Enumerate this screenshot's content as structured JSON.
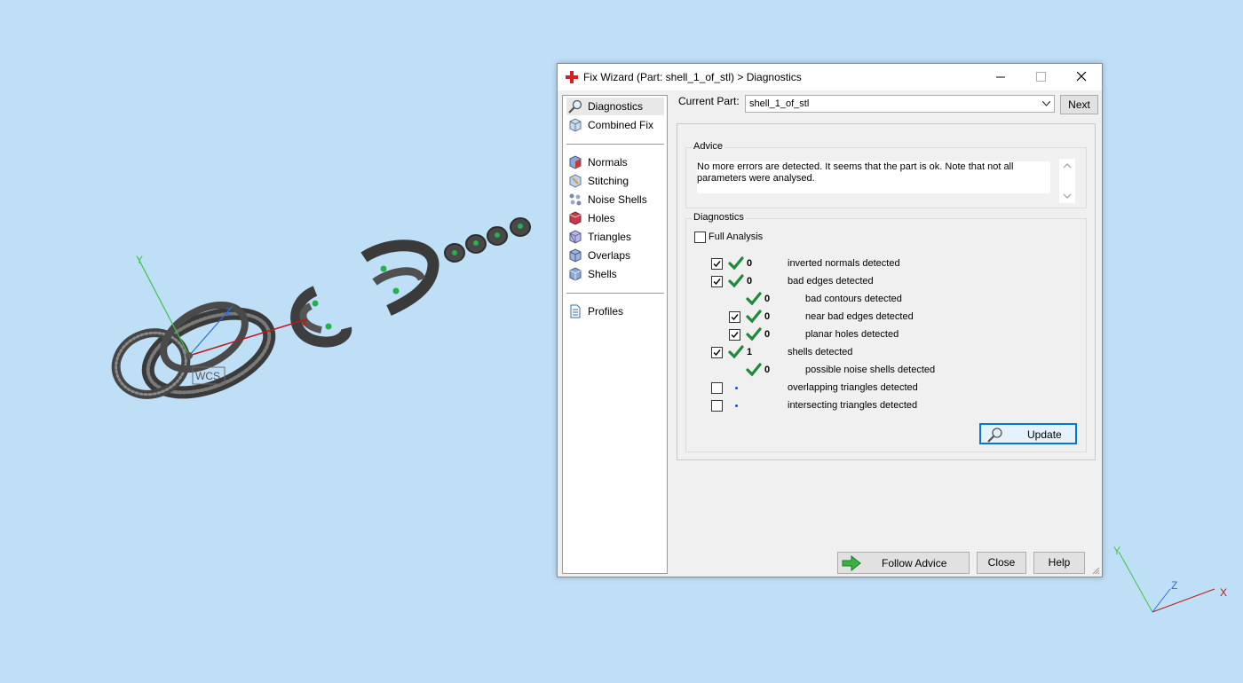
{
  "viewport": {
    "axis_labels": {
      "x": "X",
      "y": "Y",
      "z": "Z"
    },
    "wcs_label": "WCS",
    "colors": {
      "background": "#bfdff7",
      "model": "#4a4a4a",
      "marker": "#22b14c"
    }
  },
  "dialog": {
    "title": "Fix Wizard (Part: shell_1_of_stl) > Diagnostics",
    "nav": {
      "group1": [
        {
          "label": "Diagnostics",
          "icon": "magnifier-icon",
          "selected": true
        },
        {
          "label": "Combined Fix",
          "icon": "combined-fix-icon"
        }
      ],
      "group2": [
        {
          "label": "Normals",
          "icon": "normals-icon"
        },
        {
          "label": "Stitching",
          "icon": "stitching-icon"
        },
        {
          "label": "Noise Shells",
          "icon": "noise-shells-icon"
        },
        {
          "label": "Holes",
          "icon": "holes-icon"
        },
        {
          "label": "Triangles",
          "icon": "triangles-icon"
        },
        {
          "label": "Overlaps",
          "icon": "overlaps-icon"
        },
        {
          "label": "Shells",
          "icon": "shells-icon"
        }
      ],
      "group3": [
        {
          "label": "Profiles",
          "icon": "profiles-icon"
        }
      ]
    },
    "current_part": {
      "label": "Current Part:",
      "value": "shell_1_of_stl",
      "next": "Next"
    },
    "advice": {
      "title": "Advice",
      "text": "No more errors are detected. It seems that the part is ok. Note that not all parameters were analysed."
    },
    "diagnostics": {
      "title": "Diagnostics",
      "full_analysis": {
        "label": "Full Analysis",
        "checked": false
      },
      "rows": [
        {
          "checkbox": true,
          "checked": true,
          "status": "ok",
          "count": "0",
          "label": "inverted normals detected",
          "indent": 0
        },
        {
          "checkbox": true,
          "checked": true,
          "status": "ok",
          "count": "0",
          "label": "bad edges detected",
          "indent": 0
        },
        {
          "checkbox": false,
          "checked": false,
          "status": "ok",
          "count": "0",
          "label": "bad contours detected",
          "indent": 1
        },
        {
          "checkbox": true,
          "checked": true,
          "status": "ok",
          "count": "0",
          "label": "near bad edges detected",
          "indent": 1
        },
        {
          "checkbox": true,
          "checked": true,
          "status": "ok",
          "count": "0",
          "label": "planar holes detected",
          "indent": 1
        },
        {
          "checkbox": true,
          "checked": true,
          "status": "ok",
          "count": "1",
          "label": "shells detected",
          "indent": 0
        },
        {
          "checkbox": false,
          "checked": false,
          "status": "ok",
          "count": "0",
          "label": "possible noise shells detected",
          "indent": 1
        },
        {
          "checkbox": true,
          "checked": false,
          "status": "pending",
          "count": "",
          "label": "overlapping triangles detected",
          "indent": 0
        },
        {
          "checkbox": true,
          "checked": false,
          "status": "pending",
          "count": "",
          "label": "intersecting triangles detected",
          "indent": 0
        }
      ],
      "update": "Update"
    },
    "buttons": {
      "follow_advice": "Follow Advice",
      "close": "Close",
      "help": "Help"
    }
  }
}
